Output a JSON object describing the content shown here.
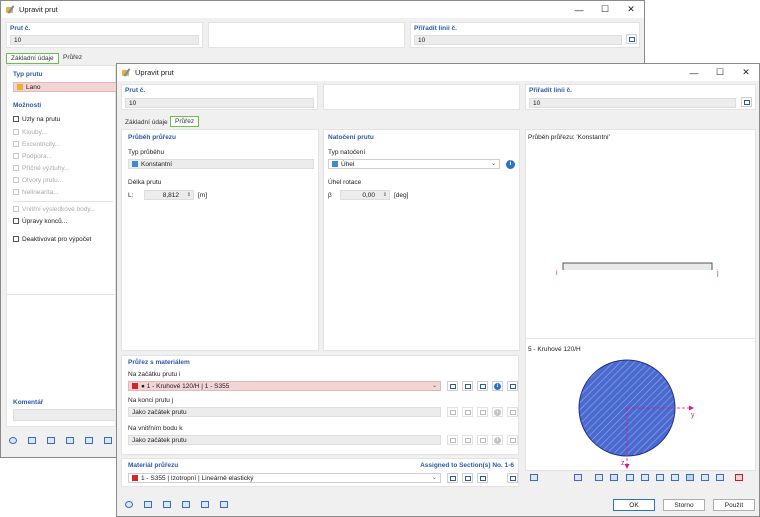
{
  "back_window": {
    "title": "Upravit prut",
    "member_no_label": "Prut č.",
    "member_no_value": "10",
    "assign_label": "Přiřadit linii č.",
    "assign_value": "10",
    "tabs": [
      "Základní údaje",
      "Průřez"
    ],
    "member_type_label": "Typ prutu",
    "member_type_value": "Lano",
    "options_label": "Možnosti",
    "options": [
      {
        "label": "Uzly na prutu",
        "enabled": true
      },
      {
        "label": "Klouby...",
        "enabled": false
      },
      {
        "label": "Excentricity...",
        "enabled": false
      },
      {
        "label": "Podpora...",
        "enabled": false
      },
      {
        "label": "Příčné výztuhy...",
        "enabled": false
      },
      {
        "label": "Otvory prutu...",
        "enabled": false
      },
      {
        "label": "Nelinearita...",
        "enabled": false
      },
      {
        "label": "Vnitřní výsledkové body...",
        "enabled": false
      },
      {
        "label": "Úpravy konců...",
        "enabled": true
      },
      {
        "label": "Deaktivovat pro výpočet",
        "enabled": true
      }
    ],
    "comment_label": "Komentář"
  },
  "front_window": {
    "title": "Upravit prut",
    "member_no_label": "Prut č.",
    "member_no_value": "10",
    "assign_label": "Přiřadit linii č.",
    "assign_value": "10",
    "tabs": [
      "Základní údaje",
      "Průřez"
    ],
    "distribution": {
      "title": "Průběh průřezu",
      "type_label": "Typ průběhu",
      "type_value": "Konstantní",
      "length_label": "Délka prutu",
      "length_symbol": "L:",
      "length_value": "8,812",
      "length_unit": "[m]"
    },
    "rotation": {
      "title": "Natočení prutu",
      "type_label": "Typ natočení",
      "type_value": "Úhel",
      "angle_label": "Úhel rotace",
      "angle_symbol": "β",
      "angle_value": "0,00",
      "angle_unit": "[deg]"
    },
    "section_material": {
      "title": "Průřez s materiálem",
      "start_label": "Na začátku prutu i",
      "start_value": "1 - Kruhové 120/H | 1 - S355",
      "end_label": "Na konci prutu j",
      "end_value": "Jako začátek prutu",
      "internal_label": "Na vnitřním bodu k",
      "internal_value": "Jako začátek prutu"
    },
    "material": {
      "title": "Materiál průřezu",
      "assigned": "Assigned to Section(s) No. 1-6",
      "value": "1 - S355 | Izotropní | Lineárně elastický"
    },
    "preview": {
      "distribution_title": "Průběh průřezu: 'Konstantní'",
      "node_i": "i",
      "node_j": "j",
      "section_title": "5 - Kruhové 120/H",
      "axis_y": "y",
      "axis_z": "z"
    },
    "buttons": {
      "ok": "OK",
      "cancel": "Storno",
      "apply": "Použít"
    }
  },
  "colors": {
    "accent_blue": "#2c5aa8",
    "tab_green": "#6bc04b",
    "material_red": "#d9252a",
    "section_fill": "#4a6ad0"
  }
}
